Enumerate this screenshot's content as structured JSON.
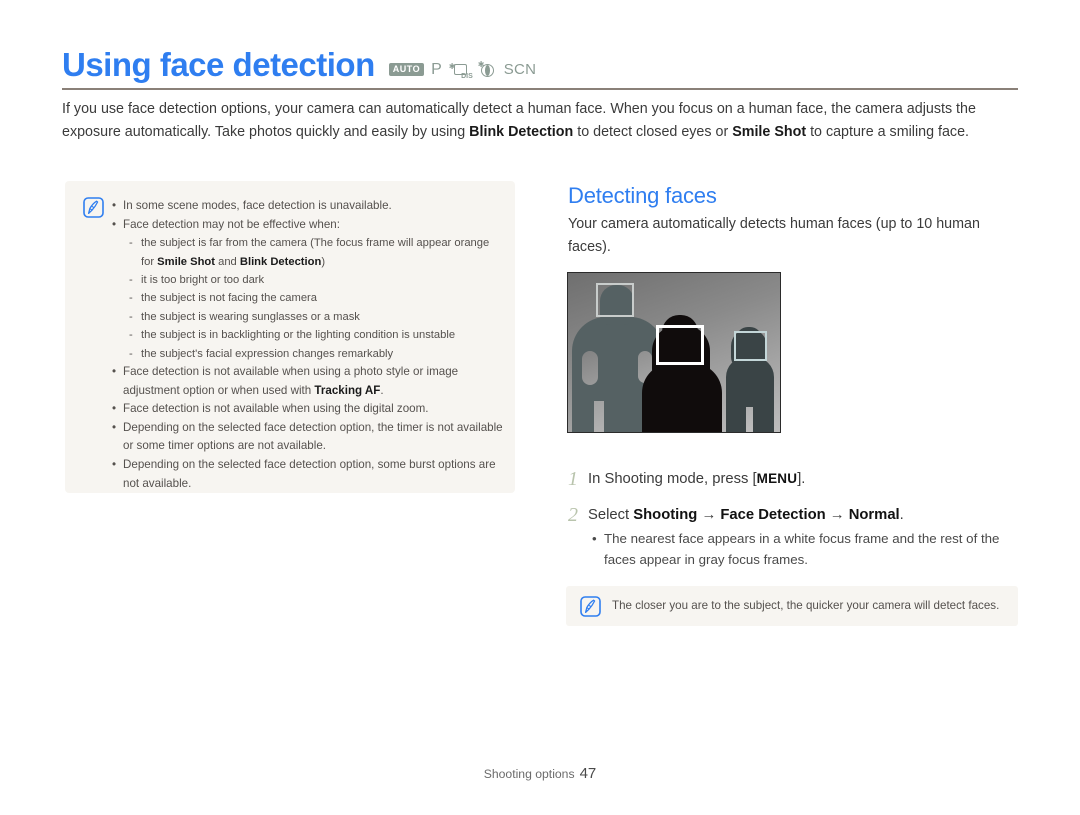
{
  "page": {
    "title": "Using face detection",
    "title_color": "#2f7ef0",
    "mode_icons": [
      {
        "name": "auto-mode-icon",
        "label": "AUTO"
      },
      {
        "name": "program-mode-icon",
        "label": "P"
      },
      {
        "name": "dis-mode-icon",
        "label": "DIS"
      },
      {
        "name": "beauty-shot-mode-icon",
        "label": ""
      },
      {
        "name": "scene-mode-icon",
        "label": "SCN"
      }
    ],
    "intro": {
      "part1": "If you use face detection options, your camera can automatically detect a human face. When you focus on a human face, the camera adjusts the exposure automatically. Take photos quickly and easily by using ",
      "bold1": "Blink Detection",
      "part2": " to detect closed eyes or ",
      "bold2": "Smile Shot",
      "part3": " to capture a smiling face."
    }
  },
  "note_left": {
    "icon": "note-pen-icon",
    "items": [
      {
        "type": "bullet",
        "text": "In some scene modes, face detection is unavailable."
      },
      {
        "type": "bullet",
        "text": "Face detection may not be effective when:"
      },
      {
        "type": "dash",
        "text": "the subject is far from the camera (The focus frame will appear orange for ",
        "bold1": "Smile Shot",
        "mid": " and ",
        "bold2": "Blink Detection",
        "tail": ")"
      },
      {
        "type": "dash",
        "text": "it is too bright or too dark"
      },
      {
        "type": "dash",
        "text": "the subject is not facing the camera"
      },
      {
        "type": "dash",
        "text": "the subject is wearing sunglasses or a mask"
      },
      {
        "type": "dash",
        "text": "the subject is in backlighting or the lighting condition is unstable"
      },
      {
        "type": "dash",
        "text": "the subject's facial expression changes remarkably"
      },
      {
        "type": "bullet",
        "text": "Face detection is not available when using a photo style or image adjustment option or when used with ",
        "bold1": "Tracking AF",
        "tail": "."
      },
      {
        "type": "bullet",
        "text": "Face detection is not available when using the digital zoom."
      },
      {
        "type": "bullet",
        "text": "Depending on the selected face detection option, the timer is not available or some timer options are not available."
      },
      {
        "type": "bullet",
        "text": "Depending on the selected face detection option, some burst options are not available."
      }
    ]
  },
  "section": {
    "heading": "Detecting faces",
    "paragraph": "Your camera automatically detects human faces (up to 10 human faces)."
  },
  "illustration": {
    "name": "face-detection-preview-image",
    "frames": [
      {
        "name": "gray-focus-frame-left",
        "color": "#c8cccb"
      },
      {
        "name": "white-focus-frame-center",
        "color": "#ffffff"
      },
      {
        "name": "gray-focus-frame-right",
        "color": "#c3d6d8"
      }
    ]
  },
  "steps": [
    {
      "number": "1",
      "pre": "In Shooting mode, press [",
      "key": "MENU",
      "post": "]."
    },
    {
      "number": "2",
      "pre": "Select ",
      "b1": "Shooting",
      "arrow1": " → ",
      "b2": "Face Detection",
      "arrow2": " → ",
      "b3": "Normal",
      "post": ".",
      "sub": "The nearest face appears in a white focus frame and the rest of the faces appear in gray focus frames."
    }
  ],
  "note_bottom": {
    "icon": "note-pen-icon",
    "text": "The closer you are to the subject, the quicker your camera will detect faces."
  },
  "footer": {
    "label": "Shooting options",
    "page_number": "47"
  }
}
